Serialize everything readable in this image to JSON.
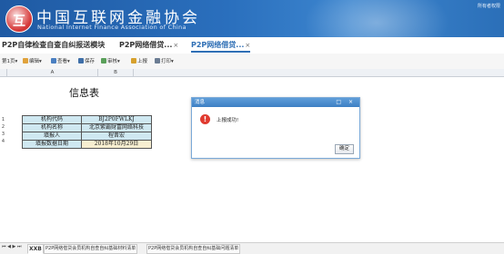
{
  "header": {
    "org_cn": "中国互联网金融协会",
    "org_en": "National Internet Finance Association of China",
    "user_link": "所有者权限"
  },
  "tabs": [
    {
      "label": "P2P自律检查自查自纠报送模块",
      "close": ""
    },
    {
      "label": "P2P网络借贷...",
      "close": "×"
    },
    {
      "label": "P2P网络借贷...",
      "close": "×"
    }
  ],
  "toolbar": {
    "sheet": "第1页",
    "edit": "编辑",
    "view": "查看",
    "save": "保存",
    "review": "审核",
    "report": "上报",
    "print": "打印"
  },
  "sheet": {
    "col_a": "A",
    "col_b": "B",
    "rows": [
      "1",
      "2",
      "3",
      "4"
    ],
    "title": "信息表",
    "info": [
      {
        "label": "机构代码",
        "value": "BJ2P0FWLKJ"
      },
      {
        "label": "机构名称",
        "value": "北京紫霸财富网络科技"
      },
      {
        "label": "填报人",
        "value": "程晋宏"
      },
      {
        "label": "填报数据日期",
        "value": "2018年10月29日"
      }
    ]
  },
  "dialog": {
    "title": "消息",
    "message": "上报成功!",
    "ok": "确定",
    "controls": "□ ×"
  },
  "bottom": {
    "nav": "⏮ ◀ ▶ ⏭",
    "sheets": [
      "XXB",
      "P2P网络借贷会员机构自查自纠基础材料清单",
      "P2P网络借贷会员机构自查自纠基础问题清单"
    ]
  },
  "colors": {
    "accent": "#2f6fb5",
    "banner": "#2a6fbd",
    "alert": "#e03a2f"
  }
}
